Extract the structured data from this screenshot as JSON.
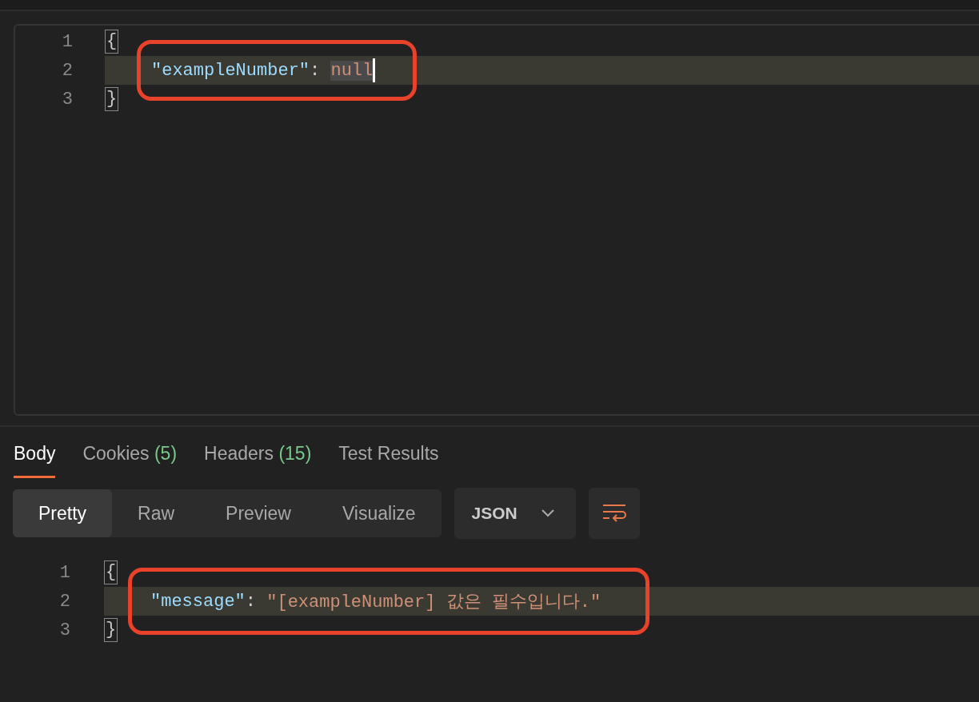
{
  "request_editor": {
    "lines": [
      {
        "number": "1",
        "active": false,
        "annotated": false,
        "tokens": [
          {
            "kind": "brace",
            "text": "{"
          }
        ]
      },
      {
        "number": "2",
        "active": true,
        "annotated": true,
        "tokens": [
          {
            "kind": "key",
            "text": "\"exampleNumber\""
          },
          {
            "kind": "punct",
            "text": ": "
          },
          {
            "kind": "null",
            "text": "null",
            "selected": true,
            "cursor": true
          }
        ]
      },
      {
        "number": "3",
        "active": false,
        "annotated": false,
        "tokens": [
          {
            "kind": "brace",
            "text": "}"
          }
        ]
      }
    ]
  },
  "response_tabs": [
    {
      "label": "Body",
      "selected": true
    },
    {
      "label": "Cookies",
      "count": "(5)",
      "selected": false
    },
    {
      "label": "Headers",
      "count": "(15)",
      "selected": false
    },
    {
      "label": "Test Results",
      "selected": false
    }
  ],
  "view_modes": [
    {
      "label": "Pretty",
      "selected": true
    },
    {
      "label": "Raw",
      "selected": false
    },
    {
      "label": "Preview",
      "selected": false
    },
    {
      "label": "Visualize",
      "selected": false
    }
  ],
  "format_dropdown": {
    "value": "JSON"
  },
  "response_editor": {
    "lines": [
      {
        "number": "1",
        "active": false,
        "annotated": false,
        "tokens": [
          {
            "kind": "brace",
            "text": "{"
          }
        ]
      },
      {
        "number": "2",
        "active": true,
        "annotated": true,
        "tokens": [
          {
            "kind": "key",
            "text": "\"message\""
          },
          {
            "kind": "punct",
            "text": ": "
          },
          {
            "kind": "string",
            "text": "\"[exampleNumber] 값은 필수입니다.\""
          }
        ]
      },
      {
        "number": "3",
        "active": false,
        "annotated": false,
        "tokens": [
          {
            "kind": "brace",
            "text": "}"
          }
        ]
      }
    ]
  }
}
